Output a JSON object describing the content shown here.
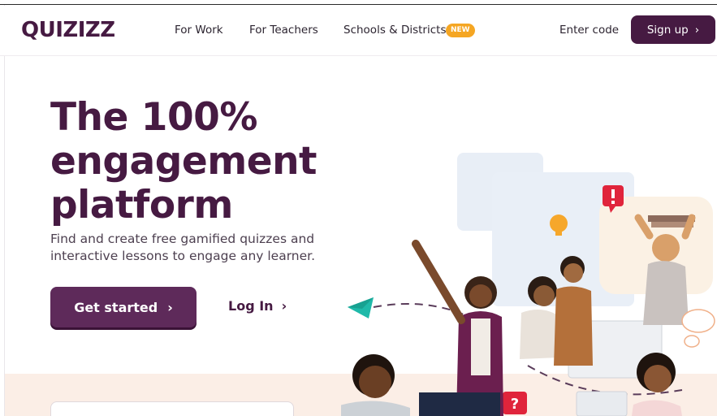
{
  "nav": {
    "logo": "QUIZIZZ",
    "links": [
      "For Work",
      "For Teachers",
      "Schools & Districts"
    ],
    "new_badge": "NEW",
    "enter_code": "Enter code",
    "signup": "Sign up",
    "signup_chevron": "›"
  },
  "hero": {
    "title_lines": [
      "The 100%",
      "engagement",
      "platform"
    ],
    "subtitle_lines": [
      "Find and create free gamified quizzes and",
      "interactive lessons to engage any learner."
    ],
    "get_started": "Get started",
    "get_started_chevron": "›",
    "login": "Log In",
    "login_chevron": "›"
  },
  "colors": {
    "brand": "#461a42",
    "button": "#5e2a5a",
    "badge": "#f5a623",
    "band": "#fbeee6"
  },
  "icons": {
    "paper_plane": "paper-plane-icon",
    "exclamation": "exclamation-bubble-icon",
    "question": "question-bubble-icon",
    "lightbulb": "lightbulb-icon"
  }
}
